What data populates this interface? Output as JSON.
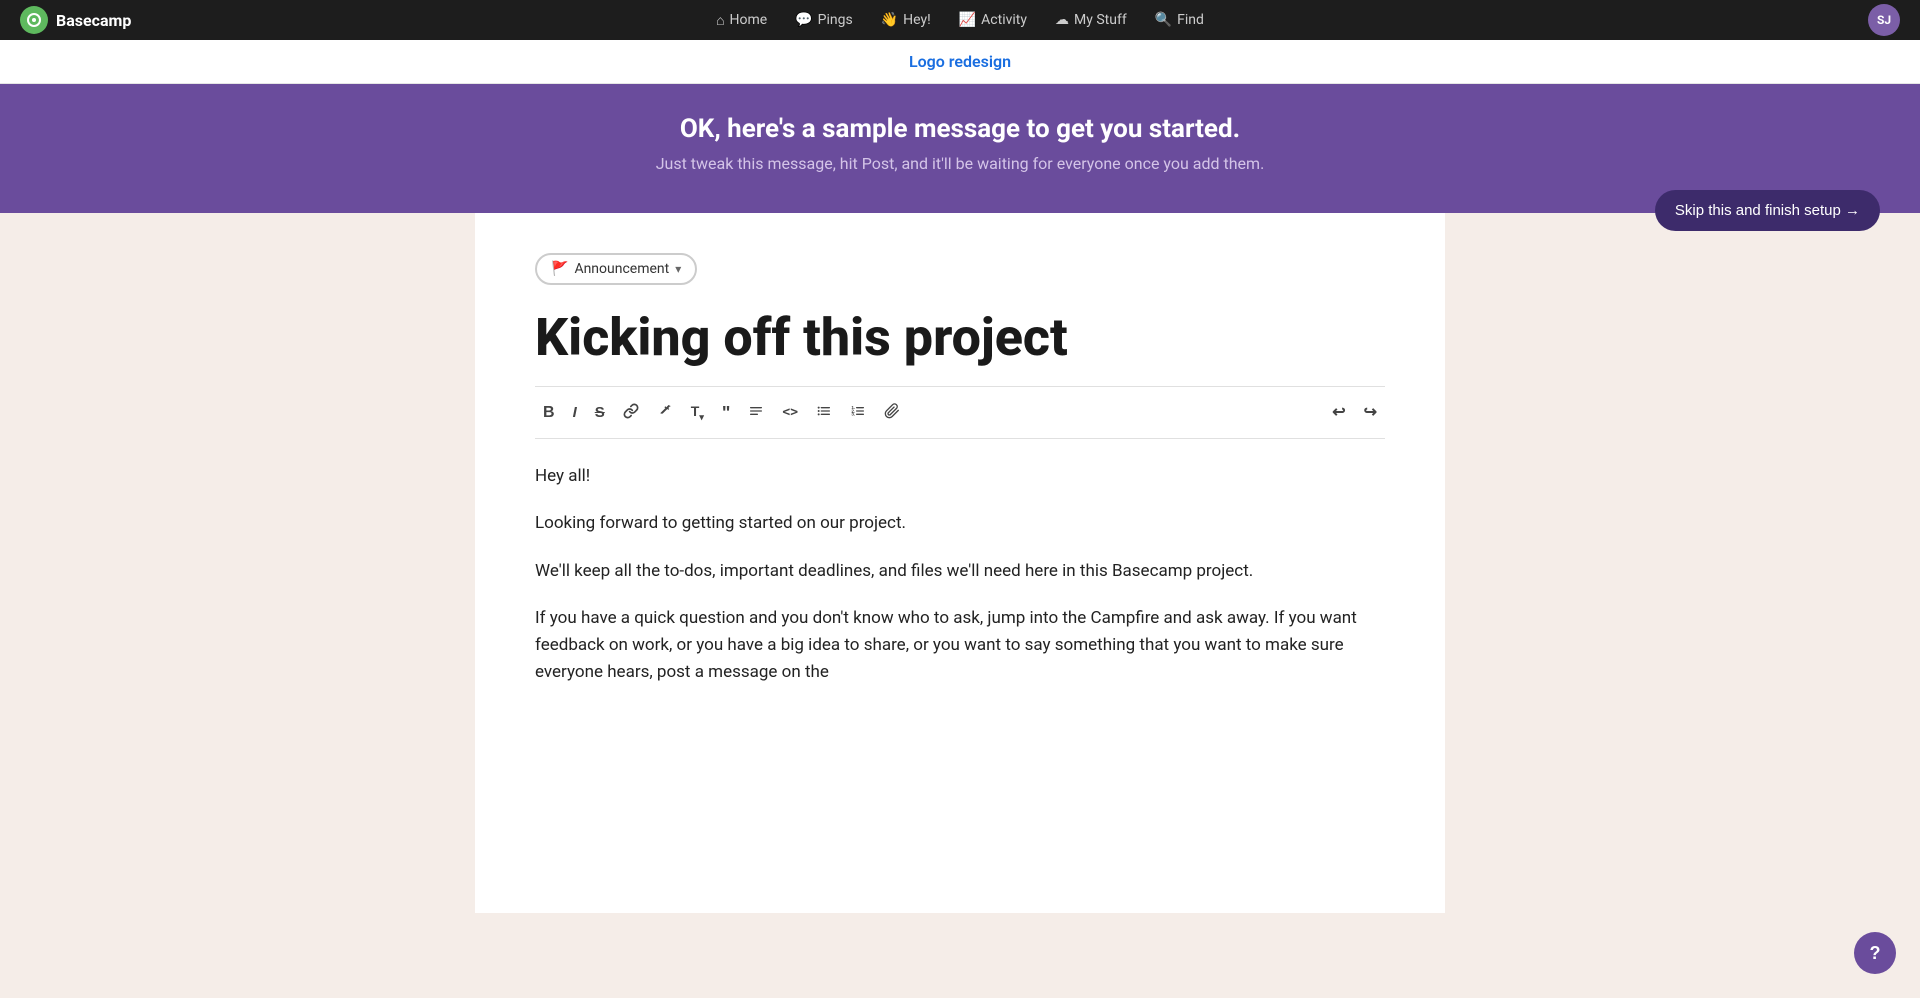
{
  "nav": {
    "logo_text": "Basecamp",
    "items": [
      {
        "id": "home",
        "label": "Home",
        "icon": "🏠"
      },
      {
        "id": "pings",
        "label": "Pings",
        "icon": "💬"
      },
      {
        "id": "hey",
        "label": "Hey!",
        "icon": "👋"
      },
      {
        "id": "activity",
        "label": "Activity",
        "icon": "📊"
      },
      {
        "id": "my-stuff",
        "label": "My Stuff",
        "icon": "☁️"
      },
      {
        "id": "find",
        "label": "Find",
        "icon": "🔍"
      }
    ],
    "avatar_initials": "SJ"
  },
  "breadcrumb": {
    "project_name": "Logo redesign"
  },
  "promo": {
    "title": "OK, here's a sample message to get you started.",
    "subtitle": "Just tweak this message, hit Post, and it'll be waiting for everyone once you add them.",
    "skip_label": "Skip this and finish setup →"
  },
  "editor": {
    "type_label": "Announcement",
    "type_icon": "🚩",
    "post_title": "Kicking off this project",
    "toolbar": {
      "bold": "B",
      "italic": "I",
      "strikethrough": "S̶",
      "link": "🔗",
      "highlight": "◈",
      "text_style": "T",
      "quote": "❝",
      "align": "≡",
      "code": "<>",
      "bullet": "•≡",
      "numbered": "1≡",
      "attach": "📎",
      "undo": "↩",
      "redo": "↪"
    },
    "content": {
      "p1": "Hey all!",
      "p2": "Looking forward to getting started on our project.",
      "p3": "We'll keep all the to-dos, important deadlines, and files we'll need here in this Basecamp project.",
      "p4": "If you have a quick question and you don't know who to ask, jump into the Campfire and ask away. If you want feedback on work, or you have a big idea to share, or you want to say something that you want to make sure everyone hears, post a message on the"
    }
  },
  "help": {
    "icon": "?"
  }
}
